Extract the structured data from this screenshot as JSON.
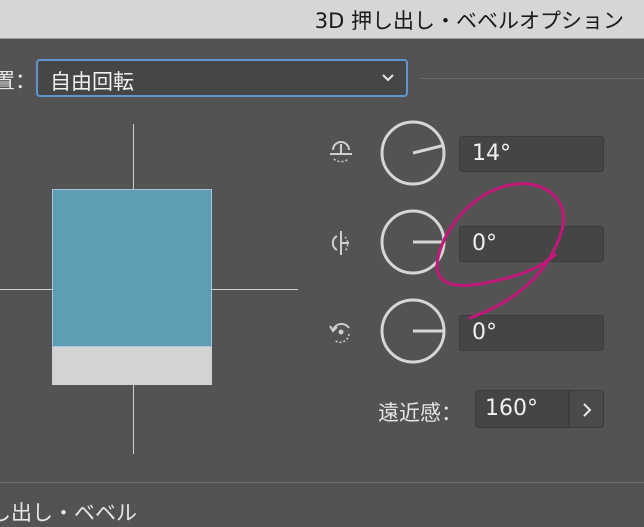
{
  "window": {
    "title": "3D 押し出し・ベベルオプション"
  },
  "position": {
    "label": "置：",
    "selected": "自由回転"
  },
  "rotation": {
    "x_value": "14°",
    "y_value": "0°",
    "z_value": "0°",
    "x_angle_deg": 14,
    "y_angle_deg": 0,
    "z_angle_deg": 0
  },
  "perspective": {
    "label": "遠近感：",
    "value": "160°"
  },
  "section": {
    "label": "し出し・ベベル"
  },
  "colors": {
    "cube_front": "#5d9eb5",
    "cube_bottom": "#d3d3d3",
    "select_border": "#5f95d1",
    "annotation": "#c2187a"
  },
  "icons": [
    "rotate-x-axis-icon",
    "rotate-y-axis-icon",
    "rotate-z-axis-icon",
    "chevron-down-icon",
    "chevron-right-icon"
  ]
}
